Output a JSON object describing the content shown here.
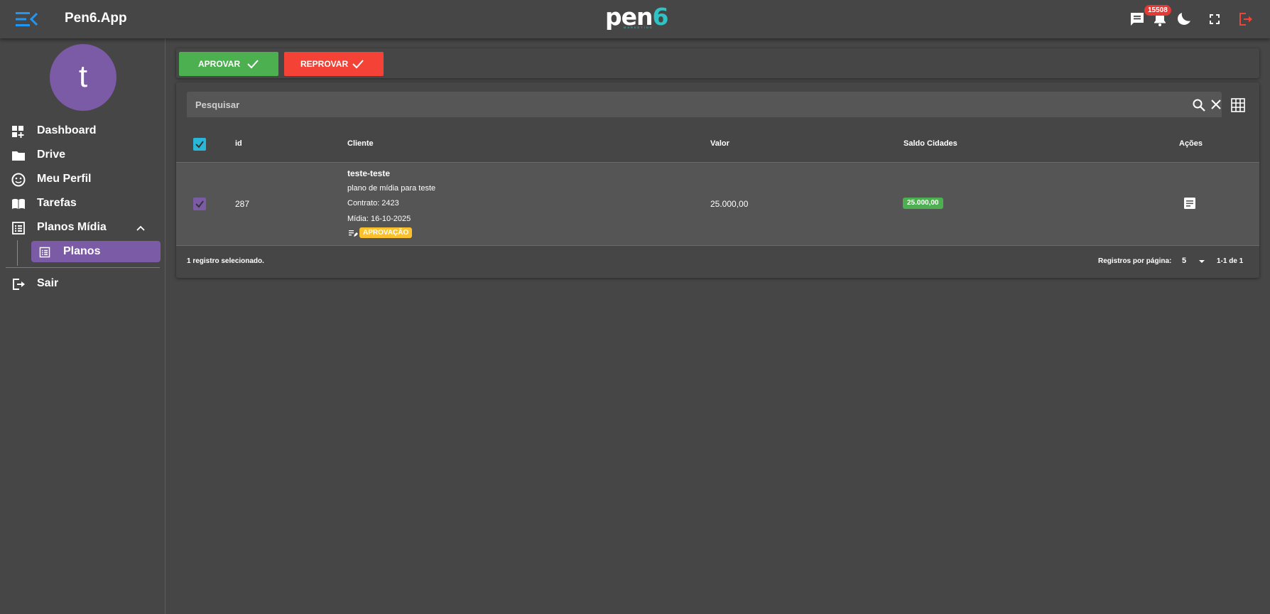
{
  "header": {
    "app_title": "Pen6.App",
    "logo_text_main": "pen",
    "logo_text_accent": "6",
    "logo_subtitle": "MARKETING",
    "notification_count": "15508",
    "icons": [
      "menu-collapse-icon",
      "chat-icon",
      "bell-icon",
      "theme-toggle-icon",
      "fullscreen-icon",
      "logout-icon"
    ],
    "colors": {
      "menu_icon": "#2196f3",
      "logout_icon": "#f44336",
      "badge": "#e53935",
      "logo_accent": "#2ec4c6"
    }
  },
  "sidebar": {
    "avatar_letter": "t",
    "avatar_color": "#7b5aa6",
    "items": [
      {
        "label": "Dashboard",
        "icon": "dashboard-icon"
      },
      {
        "label": "Drive",
        "icon": "folder-icon"
      },
      {
        "label": "Meu Perfil",
        "icon": "smiley-icon"
      },
      {
        "label": "Tarefas",
        "icon": "book-icon"
      },
      {
        "label": "Planos Mídia",
        "icon": "list-icon",
        "expanded": true
      }
    ],
    "sub_items": [
      {
        "label": "Planos",
        "icon": "list-icon",
        "active": true
      }
    ],
    "logout": {
      "label": "Sair",
      "icon": "logout-icon"
    }
  },
  "actions": {
    "approve_label": "APROVAR",
    "reject_label": "REPROVAR",
    "approve_color": "#4caf50",
    "reject_color": "#f44336"
  },
  "search": {
    "placeholder": "Pesquisar"
  },
  "table": {
    "columns": [
      "id",
      "Cliente",
      "Valor",
      "Saldo Cidades",
      "Ações"
    ],
    "rows": [
      {
        "selected": true,
        "id": "287",
        "client_name": "teste-teste",
        "plan_description": "plano de mídia para teste",
        "contract": "Contrato: 2423",
        "media_date": "Mídia: 16-10-2025",
        "status": "APROVAÇÃO",
        "valor": "25.000,00",
        "saldo_cidades": "25.000,00"
      }
    ],
    "footer": {
      "selection_text": "1 registro selecionado.",
      "rows_per_page_label": "Registros por página:",
      "rows_per_page_value": "5",
      "pagination_text": "1-1 de 1"
    }
  }
}
